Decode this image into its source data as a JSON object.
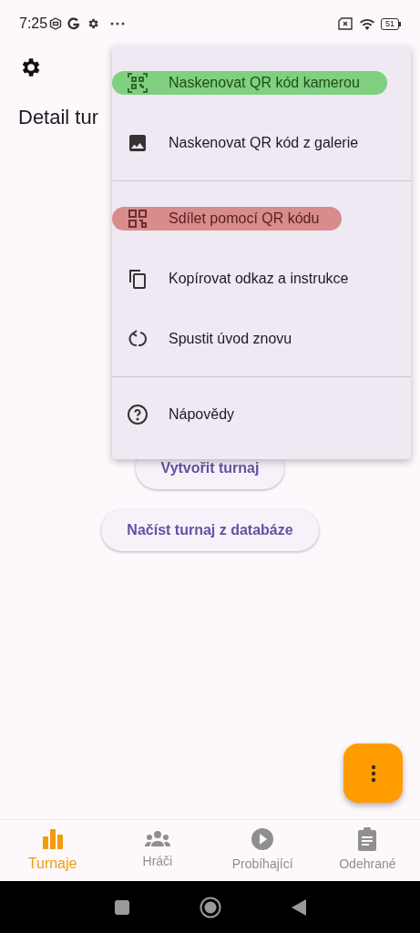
{
  "status_bar": {
    "time": "7:25",
    "battery": "51"
  },
  "page": {
    "title": "Detail tur"
  },
  "buttons": [
    {
      "label": "Vytvořit turnaj"
    },
    {
      "label": "Načíst turnaj z databáze"
    }
  ],
  "menu": {
    "groups": [
      [
        {
          "kind": "qr-scan",
          "label": "Naskenovat QR kód kamerou",
          "color": "#7fd07f"
        },
        {
          "kind": "image",
          "label": "Naskenovat QR kód z galerie"
        }
      ],
      [
        {
          "kind": "qr",
          "label": "Sdílet pomocí QR kódu",
          "color": "#d98c8c"
        },
        {
          "kind": "copy",
          "label": "Kopírovat odkaz a instrukce"
        },
        {
          "kind": "restart",
          "label": "Spustit úvod znovu"
        }
      ],
      [
        {
          "kind": "help",
          "label": "Nápovědy"
        }
      ]
    ]
  },
  "bottom_nav": [
    {
      "kind": "chart",
      "label": "Turnaje",
      "selected": true
    },
    {
      "kind": "people",
      "label": "Hráči",
      "selected": false
    },
    {
      "kind": "play",
      "label": "Probíhající",
      "selected": false
    },
    {
      "kind": "clipboard",
      "label": "Odehrané",
      "selected": false
    }
  ]
}
